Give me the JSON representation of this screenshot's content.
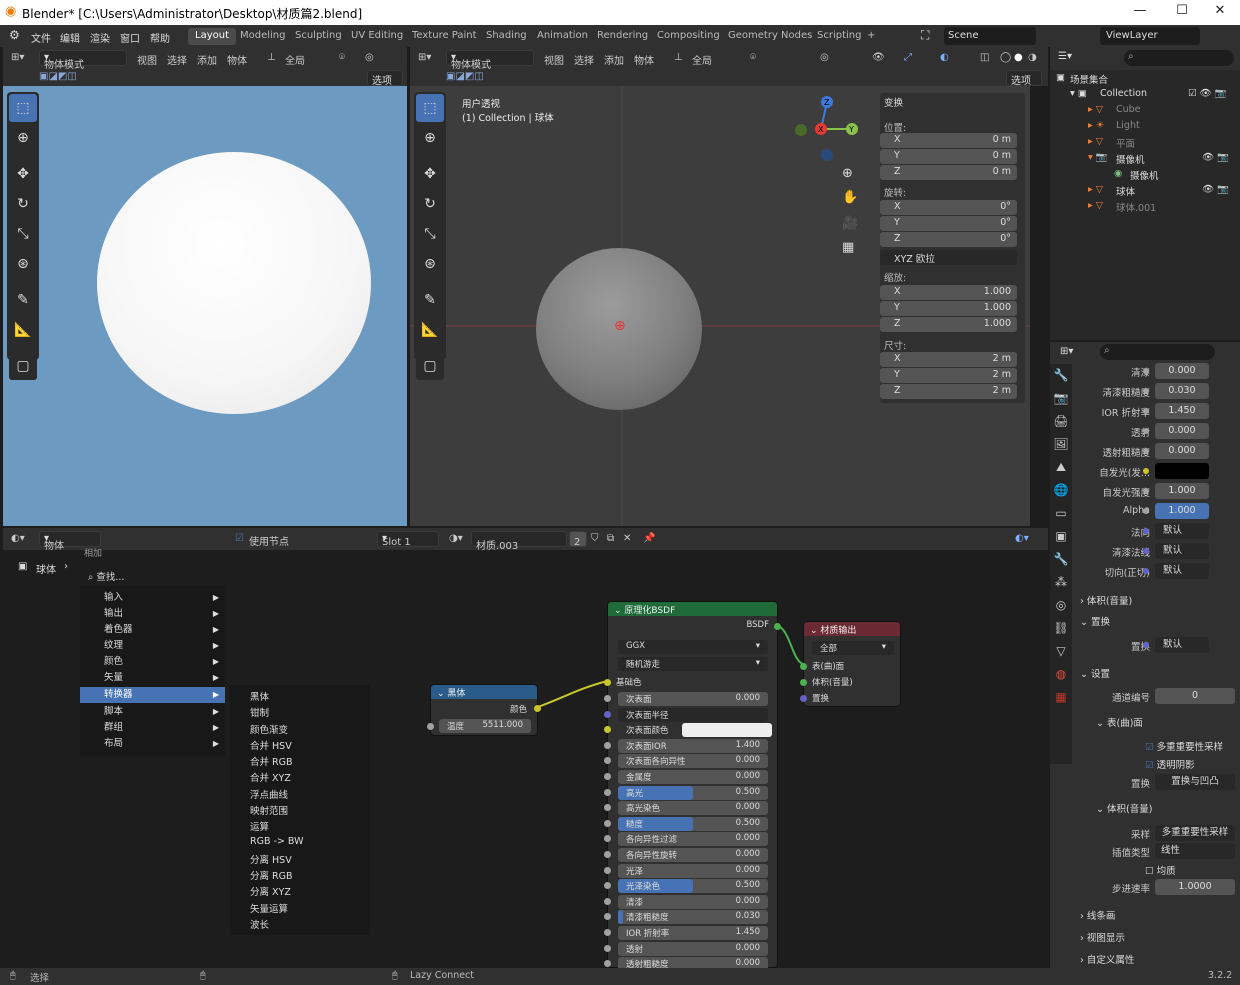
{
  "title": {
    "app_title": "Blender* [C:\\Users\\Administrator\\Desktop\\材质篇2.blend]",
    "min": "—",
    "max": "☐",
    "close": "✕"
  },
  "menus": [
    "文件",
    "编辑",
    "渲染",
    "窗口",
    "帮助"
  ],
  "workspaces": [
    "Layout",
    "Modeling",
    "Sculpting",
    "UV Editing",
    "Texture Paint",
    "Shading",
    "Animation",
    "Rendering",
    "Compositing",
    "Geometry Nodes",
    "Scripting",
    "+"
  ],
  "scene": "Scene",
  "viewlayer": "ViewLayer",
  "vp_header": {
    "mode": "物体模式",
    "view": "视图",
    "select": "选择",
    "add": "添加",
    "object": "物体",
    "global": "全局",
    "options": "选项"
  },
  "viewport": {
    "persp": "用户透视",
    "collection": "(1) Collection | 球体"
  },
  "npanel": {
    "section": "变换",
    "loc": "位置:",
    "rot": "旋转:",
    "scale": "缩放:",
    "dims": "尺寸:",
    "euler": "XYZ 欧拉",
    "locx": "0 m",
    "locy": "0 m",
    "locz": "0 m",
    "rotx": "0°",
    "roty": "0°",
    "rotz": "0°",
    "sx": "1.000",
    "sy": "1.000",
    "sz": "1.000",
    "dx": "2 m",
    "dy": "2 m",
    "dz": "2 m",
    "X": "X",
    "Y": "Y",
    "Z": "Z"
  },
  "outliner": {
    "root": "场景集合",
    "collection": "Collection",
    "items": [
      "Cube",
      "Light",
      "平面",
      "摄像机",
      "摄像机",
      "球体",
      "球体.001"
    ]
  },
  "props": {
    "rows": [
      {
        "l": "清漆",
        "v": "0.000"
      },
      {
        "l": "清漆粗糙度",
        "v": "0.030"
      },
      {
        "l": "IOR 折射率",
        "v": "1.450"
      },
      {
        "l": "透射",
        "v": "0.000"
      },
      {
        "l": "透射粗糙度",
        "v": "0.000"
      },
      {
        "l": "自发光(发...",
        "v": ""
      },
      {
        "l": "自发光强度",
        "v": "1.000"
      },
      {
        "l": "Alpha",
        "v": "1.000"
      },
      {
        "l": "法向",
        "v": "默认"
      },
      {
        "l": "清漆法线",
        "v": "默认"
      },
      {
        "l": "切向(正切)",
        "v": "默认"
      }
    ],
    "vol": "体积(音量)",
    "disp": "置换",
    "disp_l": "置换",
    "disp_v": "默认",
    "settings": "设置",
    "pass_l": "通道编号",
    "pass_v": "0",
    "surface": "表(曲)面",
    "mis": "多重重要性采样",
    "transshadow": "透明阴影",
    "disp2_l": "置换",
    "disp2_v": "置换与凹凸",
    "vol2": "体积(音量)",
    "sampling_l": "采样",
    "sampling_v": "多重重要性采样",
    "interp_l": "插值类型",
    "interp_v": "线性",
    "homog": "均质",
    "step_l": "步进速率",
    "step_v": "1.0000",
    "lineart": "线条画",
    "viewport_disp": "视图显示",
    "custom": "自定义属性"
  },
  "node_header": {
    "object": "物体",
    "use_nodes": "使用节点",
    "slot": "Slot 1",
    "material": "材质.003",
    "users": "2",
    "add": "相加"
  },
  "breadcrumb": "球体",
  "add_menu": {
    "search": "查找...",
    "items": [
      "输入",
      "输出",
      "着色器",
      "纹理",
      "颜色",
      "矢量",
      "转换器",
      "脚本",
      "群组",
      "布局"
    ]
  },
  "sub_menu": [
    "黑体",
    "钳制",
    "颜色渐变",
    "合并 HSV",
    "合并 RGB",
    "合并 XYZ",
    "浮点曲线",
    "映射范围",
    "运算",
    "RGB -> BW",
    "分离 HSV",
    "分离 RGB",
    "分离 XYZ",
    "矢量运算",
    "波长"
  ],
  "blackbody": {
    "title": "黑体",
    "out": "颜色",
    "temp_l": "温度",
    "temp_v": "5511.000"
  },
  "bsdf": {
    "title": "原理化BSDF",
    "out": "BSDF",
    "dist": "GGX",
    "sss": "随机游走",
    "base": "基础色",
    "fields": [
      {
        "k": "次表面",
        "v": "0.000",
        "f": 0
      },
      {
        "k": "次表面半径",
        "v": "",
        "f": 0
      },
      {
        "k": "次表面颜色",
        "v": "",
        "f": 0
      },
      {
        "k": "次表面IOR",
        "v": "1.400",
        "f": 0
      },
      {
        "k": "次表面各向异性",
        "v": "0.000",
        "f": 0
      },
      {
        "k": "金属度",
        "v": "0.000",
        "f": 0
      },
      {
        "k": "高光",
        "v": "0.500",
        "f": 0.5
      },
      {
        "k": "高光染色",
        "v": "0.000",
        "f": 0
      },
      {
        "k": "糙度",
        "v": "0.500",
        "f": 0.5
      },
      {
        "k": "各向异性过滤",
        "v": "0.000",
        "f": 0
      },
      {
        "k": "各向异性旋转",
        "v": "0.000",
        "f": 0
      },
      {
        "k": "光泽",
        "v": "0.000",
        "f": 0
      },
      {
        "k": "光泽染色",
        "v": "0.500",
        "f": 0.5
      },
      {
        "k": "清漆",
        "v": "0.000",
        "f": 0
      },
      {
        "k": "清漆粗糙度",
        "v": "0.030",
        "f": 0.03
      },
      {
        "k": "IOR 折射率",
        "v": "1.450",
        "f": 0
      },
      {
        "k": "透射",
        "v": "0.000",
        "f": 0
      },
      {
        "k": "透射粗糙度",
        "v": "0.000",
        "f": 0
      }
    ]
  },
  "output": {
    "title": "材质输出",
    "target": "全部",
    "surface": "表(曲)面",
    "volume": "体积(音量)",
    "disp": "置换"
  },
  "status": {
    "select": "选择",
    "lazy": "Lazy Connect",
    "version": "3.2.2"
  }
}
